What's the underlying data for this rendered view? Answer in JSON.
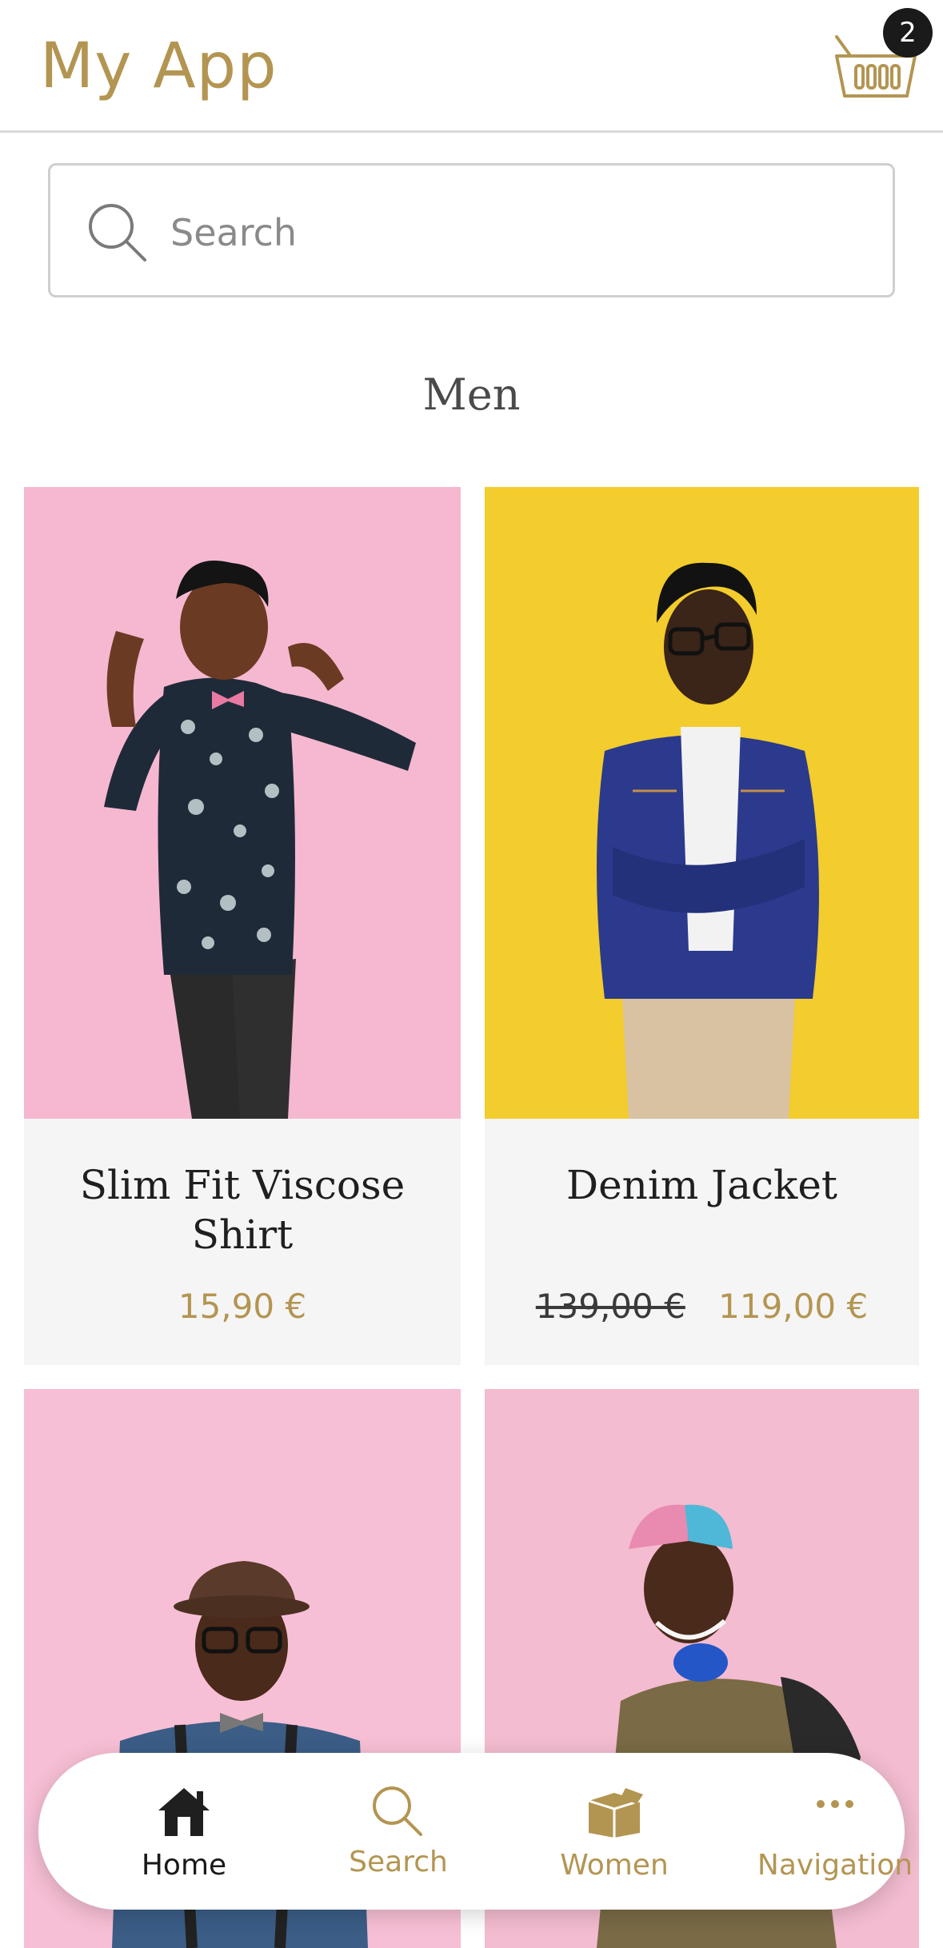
{
  "header": {
    "title": "My App",
    "cart_count": "2"
  },
  "search": {
    "placeholder": "Search"
  },
  "section": {
    "title": "Men"
  },
  "products": [
    {
      "name": "Slim Fit Viscose Shirt",
      "price": "15,90 €",
      "old_price": "",
      "bg": "#f5b8d0"
    },
    {
      "name": "Denim Jacket",
      "price": "119,00 €",
      "old_price": "139,00 €",
      "bg": "#f3cc2d"
    },
    {
      "name": "",
      "price": "",
      "old_price": "",
      "bg": "#f7bfd5"
    },
    {
      "name": "",
      "price": "",
      "old_price": "",
      "bg": "#f3bcd0"
    }
  ],
  "nav": {
    "items": [
      {
        "label": "Home",
        "icon": "home-icon",
        "active": true
      },
      {
        "label": "Search",
        "icon": "search-icon",
        "active": false
      },
      {
        "label": "Women",
        "icon": "box-icon",
        "active": false
      },
      {
        "label": "Navigation",
        "icon": "more-icon",
        "active": false
      }
    ]
  },
  "colors": {
    "accent": "#b39552",
    "dark": "#1a1a1a",
    "card_bg": "#f5f5f5"
  }
}
